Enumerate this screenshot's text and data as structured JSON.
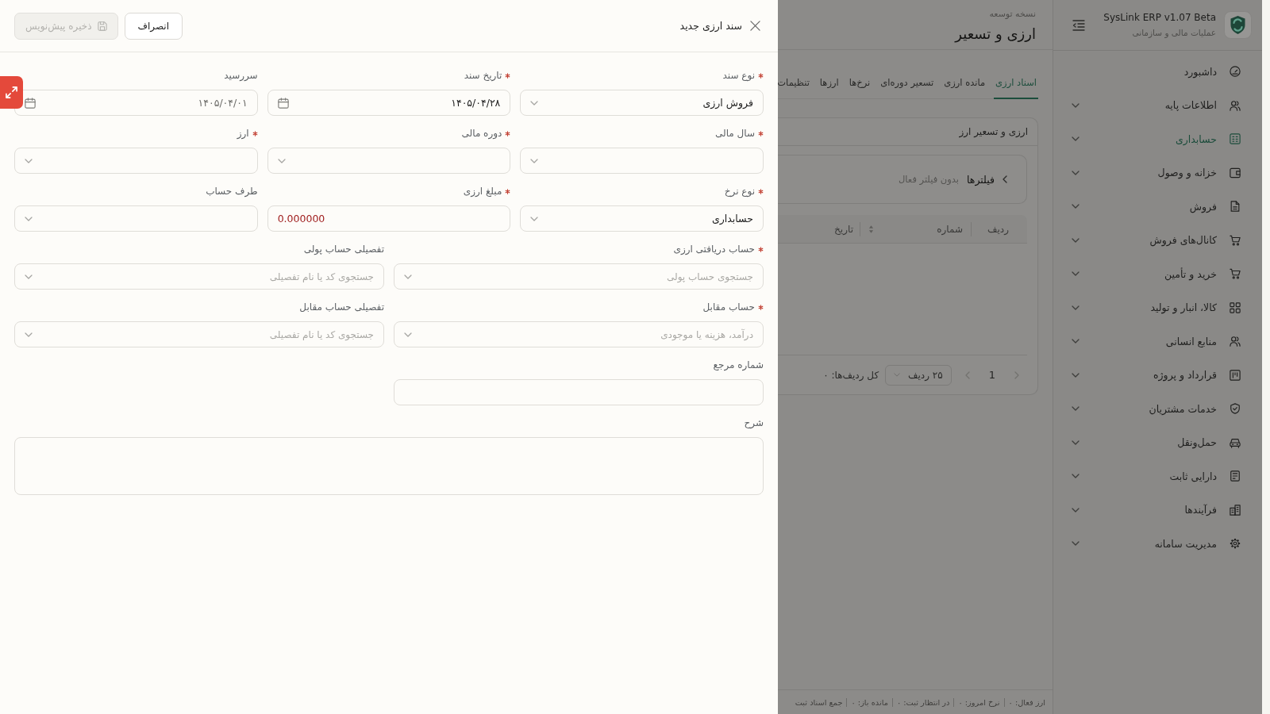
{
  "drawer": {
    "title": "سند ارزی جدید",
    "buttons": [
      {
        "kind": "cancel",
        "label": "انصراف",
        "disabled": false
      },
      {
        "kind": "save",
        "label": "ذخیره پیش‌نویس",
        "disabled": true
      }
    ],
    "form_rows": [
      [
        {
          "kind": "select",
          "label": "نوع سند",
          "required": true,
          "value": "فروش ارزی"
        },
        {
          "kind": "date",
          "label": "تاریخ سند",
          "required": true,
          "value": "۱۴۰۵/۰۴/۲۸"
        },
        {
          "kind": "date",
          "label": "سررسید",
          "required": false,
          "placeholder": "۱۴۰۵/۰۴/۰۱"
        }
      ],
      [
        {
          "kind": "select",
          "label": "سال مالی",
          "required": true
        },
        {
          "kind": "select",
          "label": "دوره مالی",
          "required": true
        },
        {
          "kind": "select",
          "label": "ارز",
          "required": true
        }
      ],
      [
        {
          "kind": "select",
          "label": "نوع نرخ",
          "required": true,
          "value": "حسابداری"
        },
        {
          "kind": "number",
          "label": "مبلغ ارزی",
          "required": true,
          "value": "0.000000"
        },
        {
          "kind": "select",
          "label": "طرف حساب",
          "required": false
        }
      ],
      [
        {
          "kind": "select",
          "label": "حساب دریافتی ارزی",
          "required": true,
          "placeholder": "جستجوی حساب پولی"
        },
        {
          "kind": "select",
          "label": "تفصیلی حساب پولی",
          "required": false,
          "placeholder": "جستجوی کد یا نام تفصیلی"
        }
      ],
      [
        {
          "kind": "select",
          "label": "حساب مقابل",
          "required": true,
          "placeholder": "درآمد، هزینه یا موجودی"
        },
        {
          "kind": "select",
          "label": "تفصیلی حساب مقابل",
          "required": false,
          "placeholder": "جستجوی کد یا نام تفصیلی"
        }
      ],
      [
        {
          "kind": "text",
          "label": "شماره مرجع",
          "required": false
        }
      ],
      [
        {
          "kind": "textarea",
          "label": "شرح",
          "required": false
        }
      ]
    ]
  },
  "page": {
    "caption": "نسخه توسعه",
    "title": "ارزی و تسعیر",
    "tabs": [
      {
        "label": "اسناد ارزی",
        "selected": true
      },
      {
        "label": "مانده ارزی",
        "selected": false
      },
      {
        "label": "تسعیر دوره‌ای",
        "selected": false
      },
      {
        "label": "نرخ‌ها",
        "selected": false
      },
      {
        "label": "ارزها",
        "selected": false
      },
      {
        "label": "تنظیمات",
        "selected": false
      }
    ],
    "card": {
      "title": "ارزی و تسعیر ارز",
      "filter": {
        "label": "فیلترها",
        "status": "بدون فیلتر فعال"
      },
      "columns": [
        {
          "label": "ردیف",
          "sortable": false
        },
        {
          "label": "شماره",
          "sortable": true
        },
        {
          "label": "تاریخ",
          "sortable": false
        }
      ],
      "pagination": {
        "page": "1",
        "page_size": "۲۵ ردیف",
        "total": "کل ردیف‌ها: ۰"
      }
    }
  },
  "status_bar": {
    "items": [
      "ارز فعال: ۰",
      "نرخ امروز: ۰",
      "در انتظار ثبت: ۰",
      "مانده باز: ۰",
      "جمع اسناد ثبت"
    ]
  },
  "sidebar": {
    "title": "SysLink ERP v1.07 Beta",
    "subtitle": "عملیات مالی و سازمانی",
    "items": [
      {
        "label": "داشبورد",
        "selected": false,
        "expandable": false
      },
      {
        "label": "اطلاعات پایه",
        "selected": false,
        "expandable": true
      },
      {
        "label": "حسابداری",
        "selected": true,
        "expandable": true
      },
      {
        "label": "خزانه و وصول",
        "selected": false,
        "expandable": true
      },
      {
        "label": "فروش",
        "selected": false,
        "expandable": true
      },
      {
        "label": "کانال‌های فروش",
        "selected": false,
        "expandable": true
      },
      {
        "label": "خرید و تأمین",
        "selected": false,
        "expandable": true
      },
      {
        "label": "کالا، انبار و تولید",
        "selected": false,
        "expandable": true
      },
      {
        "label": "منابع انسانی",
        "selected": false,
        "expandable": true
      },
      {
        "label": "قرارداد و پروژه",
        "selected": false,
        "expandable": true
      },
      {
        "label": "خدمات مشتریان",
        "selected": false,
        "expandable": true
      },
      {
        "label": "حمل‌ونقل",
        "selected": false,
        "expandable": true
      },
      {
        "label": "دارایی ثابت",
        "selected": false,
        "expandable": true
      },
      {
        "label": "فرآیندها",
        "selected": false,
        "expandable": true
      },
      {
        "label": "مدیریت سامانه",
        "selected": false,
        "expandable": true
      }
    ]
  }
}
